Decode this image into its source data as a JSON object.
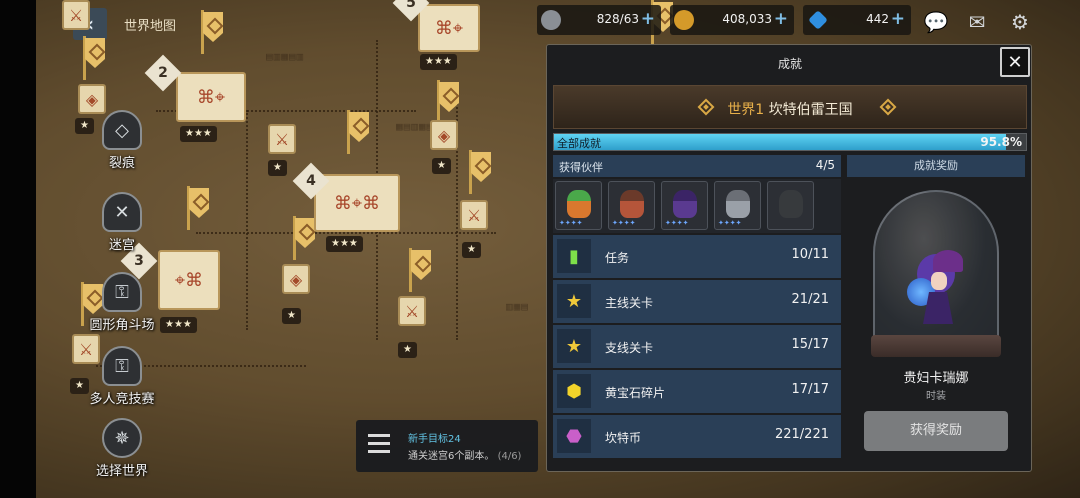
{
  "header": {
    "back_glyph": "‹",
    "title": "世界地图"
  },
  "resources": [
    {
      "name": "stamina",
      "icon": "coffee-icon",
      "value": "828/63",
      "color": "#8a8f95"
    },
    {
      "name": "gold",
      "icon": "gold-coin-icon",
      "value": "408,033",
      "color": "#d49a2a"
    },
    {
      "name": "gem",
      "icon": "gem-icon",
      "value": "442",
      "color": "#2f8fe0"
    }
  ],
  "top_icons": [
    "chat-icon",
    "mail-icon",
    "gear-icon"
  ],
  "map": {
    "badges": [
      "2",
      "4",
      "3",
      "5"
    ],
    "stars": [
      "★",
      "★★★",
      "★",
      "★★★",
      "★",
      "★",
      "★★★",
      "★",
      "★★★",
      "★",
      "★"
    ]
  },
  "left_menu": [
    {
      "label": "裂痕",
      "icon": "rift-icon"
    },
    {
      "label": "迷宫",
      "icon": "labyrinth-icon"
    },
    {
      "label": "圆形角斗场",
      "icon": "lock-icon"
    },
    {
      "label": "多人竞技赛",
      "icon": "lock-icon"
    },
    {
      "label": "选择世界",
      "icon": "compass-icon"
    }
  ],
  "panel": {
    "title": "成就",
    "close_glyph": "✕",
    "world_label": "世界1",
    "world_name": "坎特伯雷王国",
    "progress_label": "全部成就",
    "progress_value": 95.8,
    "progress_text": "95.8%",
    "partners_label": "获得伙伴",
    "partners_count": "4/5",
    "partners": [
      {
        "color": "#d9782e",
        "hair": "#4aa84a",
        "locked": false,
        "lvl": "✦✦✦✦"
      },
      {
        "color": "#b5553a",
        "hair": "#6b3a2a",
        "locked": false,
        "lvl": "✦✦✦✦"
      },
      {
        "color": "#5a3a90",
        "hair": "#3b2466",
        "locked": false,
        "lvl": "✦✦✦✦"
      },
      {
        "color": "#9aa0a8",
        "hair": "#6b6f76",
        "locked": false,
        "lvl": "✦✦✦✦"
      },
      {
        "color": "#3b3d40",
        "hair": "#3b3d40",
        "locked": true,
        "lvl": ""
      }
    ],
    "achievements": [
      {
        "name": "任务",
        "done": "10",
        "total": "11",
        "icon": "bookmark-icon",
        "glyph": "▮",
        "color": "#7ee04a"
      },
      {
        "name": "主线关卡",
        "done": "21",
        "total": "21",
        "icon": "stars-icon",
        "glyph": "★",
        "color": "#f0c93a"
      },
      {
        "name": "支线关卡",
        "done": "15",
        "total": "17",
        "icon": "star-icon",
        "glyph": "★",
        "color": "#f0c93a"
      },
      {
        "name": "黄宝石碎片",
        "done": "17",
        "total": "17",
        "icon": "yellow-gem-icon",
        "glyph": "⬢",
        "color": "#f2d32a"
      },
      {
        "name": "坎特币",
        "done": "221",
        "total": "221",
        "icon": "kanter-coin-icon",
        "glyph": "⬣",
        "color": "#c95fc9"
      }
    ],
    "reward_head": "成就奖励",
    "reward_name": "贵妇卡瑞娜",
    "reward_type": "时装",
    "claim_label": "获得奖励"
  },
  "quest": {
    "title": "新手目标24",
    "desc": "通关迷宫6个副本。",
    "progress": "(4/6)"
  }
}
